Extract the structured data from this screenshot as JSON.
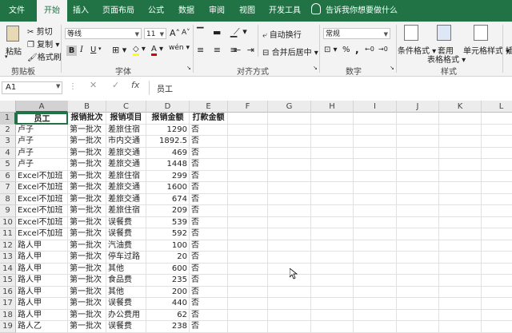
{
  "tabs": [
    "文件",
    "开始",
    "插入",
    "页面布局",
    "公式",
    "数据",
    "审阅",
    "视图",
    "开发工具"
  ],
  "tell_me": "告诉我你想要做什么",
  "clipboard": {
    "paste": "粘贴",
    "cut": "剪切",
    "copy": "复制",
    "format_painter": "格式刷",
    "group": "剪贴板"
  },
  "font": {
    "name": "等线",
    "size": "11",
    "bold": "B",
    "italic": "I",
    "underline": "U",
    "group": "字体",
    "grow": "A",
    "shrink": "A",
    "wen": "wén"
  },
  "alignment": {
    "wrap": "自动换行",
    "merge": "合并后居中",
    "group": "对齐方式"
  },
  "number": {
    "format": "常规",
    "group": "数字",
    "percent": "%",
    "comma": ","
  },
  "styles": {
    "cond": "条件格式",
    "table": "套用\n表格格式",
    "cell": "单元格样式",
    "group": "样式",
    "insert": "插"
  },
  "formula_bar": {
    "name_box": "A1",
    "content": "员工",
    "fx": "fx",
    "cancel": "✕",
    "enter": "✓"
  },
  "columns": [
    "A",
    "B",
    "C",
    "D",
    "E",
    "F",
    "G",
    "H",
    "I",
    "J",
    "K",
    "L"
  ],
  "header_row": [
    "员工",
    "报销批次",
    "报销项目",
    "报销金额",
    "打款金额"
  ],
  "rows": [
    [
      "卢子",
      "第一批次",
      "差旅住宿",
      "1290",
      "否"
    ],
    [
      "卢子",
      "第一批次",
      "市内交通",
      "1892.5",
      "否"
    ],
    [
      "卢子",
      "第一批次",
      "差旅交通",
      "469",
      "否"
    ],
    [
      "卢子",
      "第一批次",
      "差旅交通",
      "1448",
      "否"
    ],
    [
      "Excel不加班",
      "第一批次",
      "差旅住宿",
      "299",
      "否"
    ],
    [
      "Excel不加班",
      "第一批次",
      "差旅交通",
      "1600",
      "否"
    ],
    [
      "Excel不加班",
      "第一批次",
      "差旅交通",
      "674",
      "否"
    ],
    [
      "Excel不加班",
      "第一批次",
      "差旅住宿",
      "209",
      "否"
    ],
    [
      "Excel不加班",
      "第一批次",
      "误餐费",
      "539",
      "否"
    ],
    [
      "Excel不加班",
      "第一批次",
      "误餐费",
      "592",
      "否"
    ],
    [
      "路人甲",
      "第一批次",
      "汽油费",
      "100",
      "否"
    ],
    [
      "路人甲",
      "第一批次",
      "停车过路",
      "20",
      "否"
    ],
    [
      "路人甲",
      "第一批次",
      "其他",
      "600",
      "否"
    ],
    [
      "路人甲",
      "第一批次",
      "食品费",
      "235",
      "否"
    ],
    [
      "路人甲",
      "第一批次",
      "其他",
      "200",
      "否"
    ],
    [
      "路人甲",
      "第一批次",
      "误餐费",
      "440",
      "否"
    ],
    [
      "路人甲",
      "第一批次",
      "办公费用",
      "62",
      "否"
    ],
    [
      "路人乙",
      "第一批次",
      "误餐费",
      "238",
      "否"
    ]
  ],
  "colors": {
    "excel_green": "#217346",
    "ribbon_bg": "#f3f3f3"
  }
}
